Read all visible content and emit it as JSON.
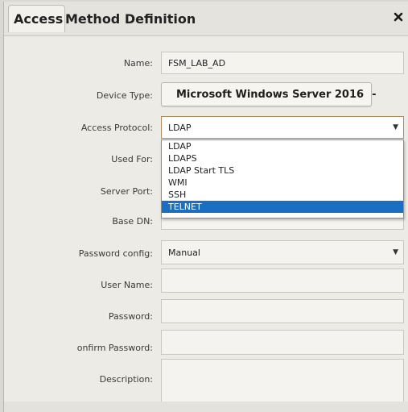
{
  "dialog": {
    "title_tab": "Access",
    "title_rest": "Method Definition"
  },
  "form": {
    "name_label": "Name:",
    "name_value": "FSM_LAB_AD",
    "device_type_label": "Device Type:",
    "device_type_value": "Microsoft Windows Server 2016",
    "access_protocol_label": "Access Protocol:",
    "access_protocol_value": "LDAP",
    "used_for_label": "Used For:",
    "server_port_label": "Server Port:",
    "base_dn_label": "Base DN:",
    "password_config_label": "Password config:",
    "password_config_value": "Manual",
    "user_name_label": "User Name:",
    "password_label": "Password:",
    "confirm_password_label": "onfirm Password:",
    "description_label": "Description:"
  },
  "dropdown": {
    "options": [
      "LDAP",
      "LDAPS",
      "LDAP Start TLS",
      "WMI",
      "SSH",
      "TELNET"
    ],
    "highlighted": "TELNET"
  },
  "colors": {
    "highlight": "#1a6fc2",
    "active_border": "#b48a5c"
  }
}
